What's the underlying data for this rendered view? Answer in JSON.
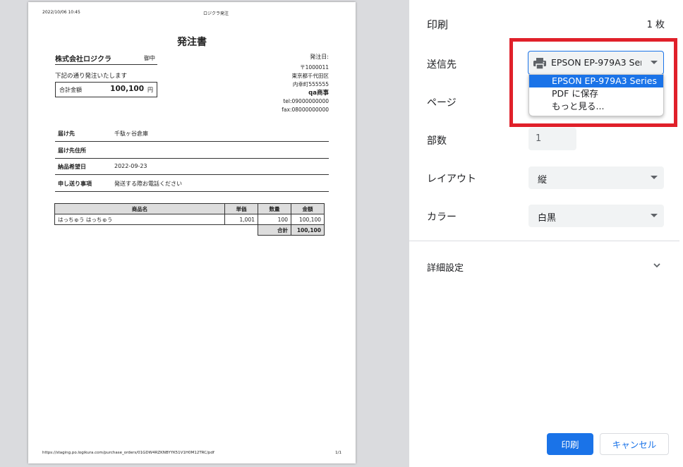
{
  "document": {
    "header_date": "2022/10/06 10:45",
    "header_title": "ロジクラ発注",
    "title": "発注書",
    "recipient_company": "株式会社ロジクラ",
    "recipient_honorific": "御中",
    "order_date_label": "発注日:",
    "intro": "下記の通り発注いたします",
    "total_label": "合計金額",
    "total_value": "100,100",
    "total_unit": "円",
    "sender": {
      "postal": "〒1000011",
      "address1": "東京都千代田区",
      "address2": "内幸町555555",
      "name": "qa商事",
      "tel": "tel:09000000000",
      "fax": "fax:08000000000"
    },
    "info_rows": [
      {
        "label": "届け先",
        "value": "千駄ヶ谷倉庫"
      },
      {
        "label": "届け先住所",
        "value": ""
      },
      {
        "label": "納品希望日",
        "value": "2022-09-23"
      },
      {
        "label": "申し送り事項",
        "value": "発送する際お電話ください"
      }
    ],
    "table": {
      "headers": [
        "商品名",
        "単価",
        "数量",
        "金額"
      ],
      "rows": [
        {
          "name": "はっちゅう はっちゅう",
          "price": "1,001",
          "qty": "100",
          "amount": "100,100"
        }
      ],
      "sum_label": "合計",
      "sum_value": "100,100"
    },
    "footer_url": "https://staging.po.logikura.com/purchase_orders/01GDW4RZKNBYYK51V1H0M12TRC/pdf",
    "footer_page": "1/1"
  },
  "panel": {
    "title": "印刷",
    "sheet_count": "1 枚",
    "destination_label": "送信先",
    "destination_value": "EPSON EP-979A3 Series",
    "destination_options": [
      "EPSON EP-979A3 Series",
      "PDF に保存",
      "もっと見る..."
    ],
    "pages_label": "ページ",
    "copies_label": "部数",
    "copies_value": "1",
    "layout_label": "レイアウト",
    "layout_value": "縦",
    "color_label": "カラー",
    "color_value": "白黒",
    "more_settings_label": "詳細設定",
    "print_button": "印刷",
    "cancel_button": "キャンセル"
  },
  "colors": {
    "accent": "#1a73e8",
    "highlight": "#e0202a",
    "select_bg": "#f1f3f4"
  }
}
